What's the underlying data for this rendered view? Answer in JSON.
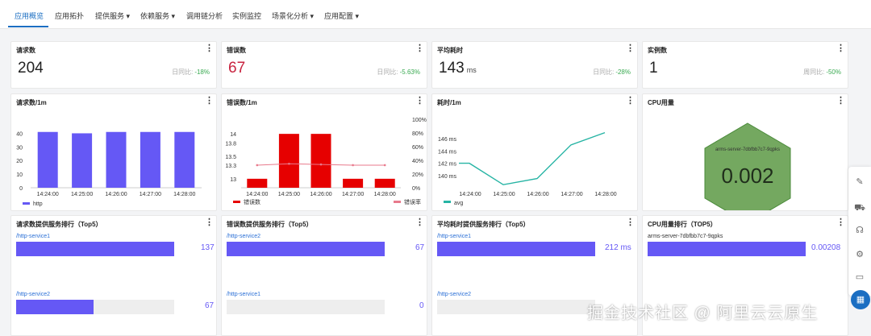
{
  "tabs": [
    {
      "label": "应用概览"
    },
    {
      "label": "应用拓扑"
    },
    {
      "label": "提供服务 ▾"
    },
    {
      "label": "依赖服务 ▾"
    },
    {
      "label": "调用链分析"
    },
    {
      "label": "实例监控"
    },
    {
      "label": "场景化分析 ▾"
    },
    {
      "label": "应用配置 ▾"
    }
  ],
  "more_glyph": "⋮",
  "stats": [
    {
      "title": "请求数",
      "value": "204",
      "unit": "",
      "compare_label": "日同比:",
      "compare_pct": "-18%"
    },
    {
      "title": "错误数",
      "value": "67",
      "unit": "",
      "compare_label": "日同比:",
      "compare_pct": "-5.63%"
    },
    {
      "title": "平均耗时",
      "value": "143",
      "unit": "ms",
      "compare_label": "日同比:",
      "compare_pct": "-28%"
    },
    {
      "title": "实例数",
      "value": "1",
      "unit": "",
      "compare_label": "周同比:",
      "compare_pct": "-50%"
    }
  ],
  "charts_titles": {
    "requests": "请求数/1m",
    "errors": "错误数/1m",
    "latency": "耗时/1m",
    "cpu": "CPU用量"
  },
  "chart_data": [
    {
      "type": "bar",
      "title": "请求数/1m",
      "categories": [
        "14:24:00",
        "14:25:00",
        "14:26:00",
        "14:27:00",
        "14:28:00"
      ],
      "series": [
        {
          "name": "http",
          "values": [
            41,
            40,
            41,
            41,
            41
          ]
        }
      ],
      "ylim": [
        0,
        45
      ],
      "yticks": [
        0,
        10,
        20,
        30,
        40
      ],
      "legend": "bottom-left",
      "color": "#6558f5"
    },
    {
      "type": "bar",
      "title": "错误数/1m",
      "categories": [
        "14:24:00",
        "14:25:00",
        "14:26:00",
        "14:27:00",
        "14:28:00"
      ],
      "series": [
        {
          "name": "错误数",
          "values": [
            13,
            14,
            14,
            13,
            13
          ]
        },
        {
          "name": "错误率",
          "values": [
            33,
            35,
            34,
            33,
            33
          ],
          "axis": "right"
        }
      ],
      "ylim": [
        12.8,
        14.2
      ],
      "yticks": [
        "13",
        "13.3",
        "13.5",
        "13.8",
        "14"
      ],
      "y2ticks": [
        "0%",
        "20%",
        "40%",
        "60%",
        "80%",
        "100%"
      ],
      "legend": "bottom",
      "colors": [
        "#e60000",
        "#e87a8c"
      ]
    },
    {
      "type": "line",
      "title": "耗时/1m",
      "categories": [
        "14:24:00",
        "14:25:00",
        "14:26:00",
        "14:27:00",
        "14:28:00"
      ],
      "series": [
        {
          "name": "avg",
          "values": [
            142,
            138.5,
            139.5,
            145,
            147
          ]
        }
      ],
      "ylim": [
        138,
        148
      ],
      "yticks": [
        "140 ms",
        "142 ms",
        "144 ms",
        "146 ms"
      ],
      "legend": "bottom-left",
      "color": "#26b4a4"
    }
  ],
  "cpu": {
    "host": "arms-server-7dbfbb7c7-9qpks",
    "value": "0.002",
    "fill": "#74a860"
  },
  "ranks": [
    {
      "title": "请求数提供服务排行（Top5）",
      "items": [
        {
          "label": "/http-service1",
          "value": "137",
          "fraction": 1.0
        },
        {
          "label": "/http-service2",
          "value": "67",
          "fraction": 0.49
        }
      ]
    },
    {
      "title": "错误数提供服务排行（Top5）",
      "items": [
        {
          "label": "/http-service2",
          "value": "67",
          "fraction": 1.0
        },
        {
          "label": "/http-service1",
          "value": "0",
          "fraction": 0.0
        }
      ]
    },
    {
      "title": "平均耗时提供服务排行（Top5）",
      "items": [
        {
          "label": "/http-service1",
          "value": "212 ms",
          "fraction": 1.0
        },
        {
          "label": "/http-service2",
          "value": "",
          "fraction": 0.0
        }
      ]
    },
    {
      "title": "CPU用量排行（TOP5）",
      "items": [
        {
          "label": "arms-server-7dbfbb7c7-9qpks",
          "value": "0.00208",
          "fraction": 1.0
        }
      ]
    }
  ],
  "floating_icons": [
    "edit-icon",
    "cart-icon",
    "headset-icon",
    "settings-icon",
    "feedback-icon"
  ],
  "watermark": "掘金技术社区 @ 阿里云云原生"
}
